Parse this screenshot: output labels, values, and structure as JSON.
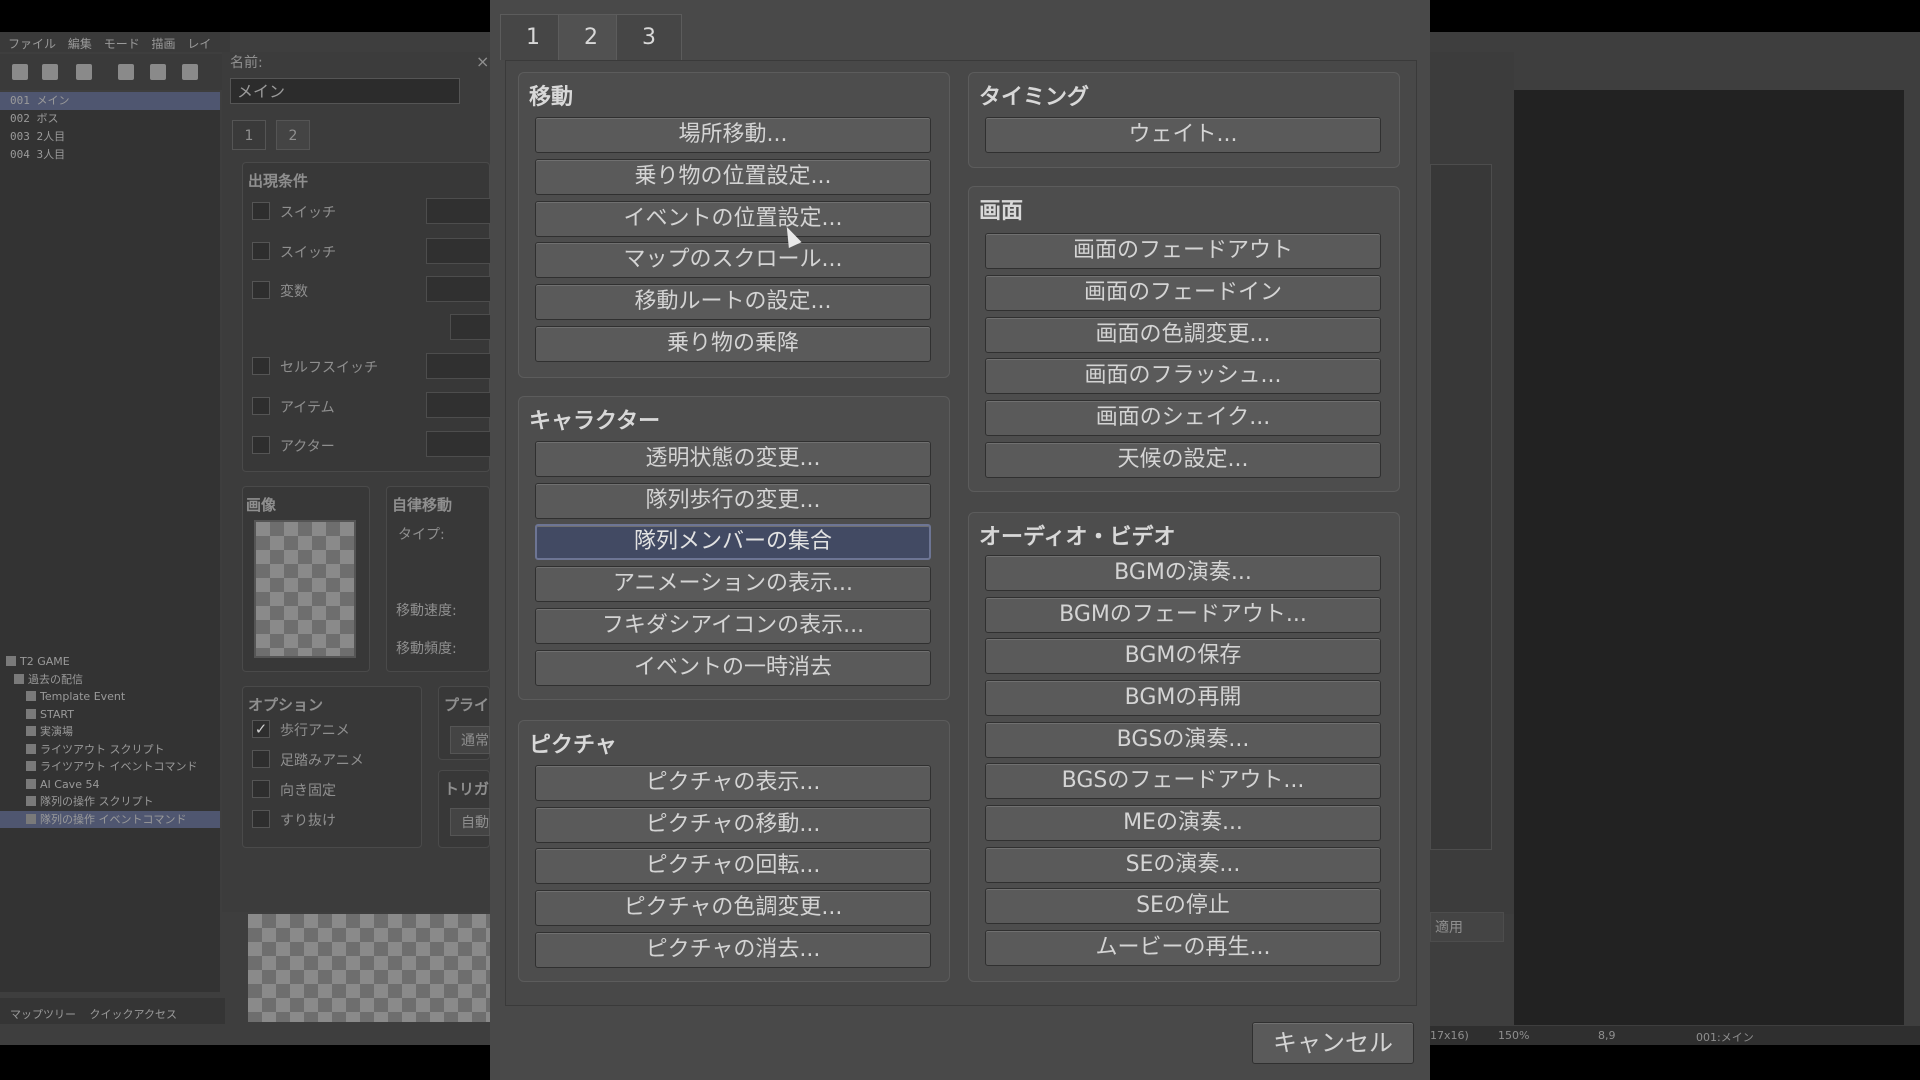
{
  "background_editor": {
    "menu": [
      "ファイル",
      "編集",
      "モード",
      "描画",
      "レイ"
    ],
    "maps": [
      "001 メイン",
      "002 ボス",
      "003 2人目",
      "004 3人目"
    ],
    "tree": [
      "T2 GAME",
      "過去の配信",
      "Template Event",
      "START",
      "実演場",
      "ライツアウト スクリプト",
      "ライツアウト イベントコマンド",
      "AI Cave 54",
      "隊列の操作 スクリプト",
      "隊列の操作 イベントコマンド"
    ],
    "bottom_tabs": [
      "マップツリー",
      "クイックアクセス"
    ],
    "name_label": "名前:",
    "name_value": "メイン",
    "close_glyph": "×",
    "page_tabs": [
      "1",
      "2"
    ],
    "conditions": {
      "title": "出現条件",
      "items": [
        "スイッチ",
        "スイッチ",
        "変数",
        "セルフスイッチ",
        "アイテム",
        "アクター"
      ]
    },
    "image_label": "画像",
    "autonomous": {
      "title": "自律移動",
      "type": "タイプ:",
      "speed": "移動速度:",
      "freq": "移動頻度:"
    },
    "options": {
      "title": "オプション",
      "items": [
        {
          "label": "歩行アニメ",
          "checked": true
        },
        {
          "label": "足踏みアニメ",
          "checked": false
        },
        {
          "label": "向き固定",
          "checked": false
        },
        {
          "label": "すり抜け",
          "checked": false
        }
      ]
    },
    "priority": {
      "title": "プライ",
      "value": "通常"
    },
    "trigger": {
      "title": "トリガ",
      "value": "自動"
    },
    "apply_label": "適用",
    "status": [
      "17x16)",
      "150%",
      "8,9",
      "001:メイン"
    ]
  },
  "dialog": {
    "tabs": [
      "1",
      "2",
      "3"
    ],
    "active_tab": 1,
    "sections": {
      "movement": {
        "title": "移動",
        "buttons": [
          "場所移動...",
          "乗り物の位置設定...",
          "イベントの位置設定...",
          "マップのスクロール...",
          "移動ルートの設定...",
          "乗り物の乗降"
        ]
      },
      "character": {
        "title": "キャラクター",
        "buttons": [
          "透明状態の変更...",
          "隊列歩行の変更...",
          "隊列メンバーの集合",
          "アニメーションの表示...",
          "フキダシアイコンの表示...",
          "イベントの一時消去"
        ],
        "selected_index": 2
      },
      "picture": {
        "title": "ピクチャ",
        "buttons": [
          "ピクチャの表示...",
          "ピクチャの移動...",
          "ピクチャの回転...",
          "ピクチャの色調変更...",
          "ピクチャの消去..."
        ]
      },
      "timing": {
        "title": "タイミング",
        "buttons": [
          "ウェイト..."
        ]
      },
      "screen": {
        "title": "画面",
        "buttons": [
          "画面のフェードアウト",
          "画面のフェードイン",
          "画面の色調変更...",
          "画面のフラッシュ...",
          "画面のシェイク...",
          "天候の設定..."
        ]
      },
      "audio_video": {
        "title": "オーディオ・ビデオ",
        "buttons": [
          "BGMの演奏...",
          "BGMのフェードアウト...",
          "BGMの保存",
          "BGMの再開",
          "BGSの演奏...",
          "BGSのフェードアウト...",
          "MEの演奏...",
          "SEの演奏...",
          "SEの停止",
          "ムービーの再生..."
        ]
      }
    },
    "cancel_label": "キャンセル"
  }
}
